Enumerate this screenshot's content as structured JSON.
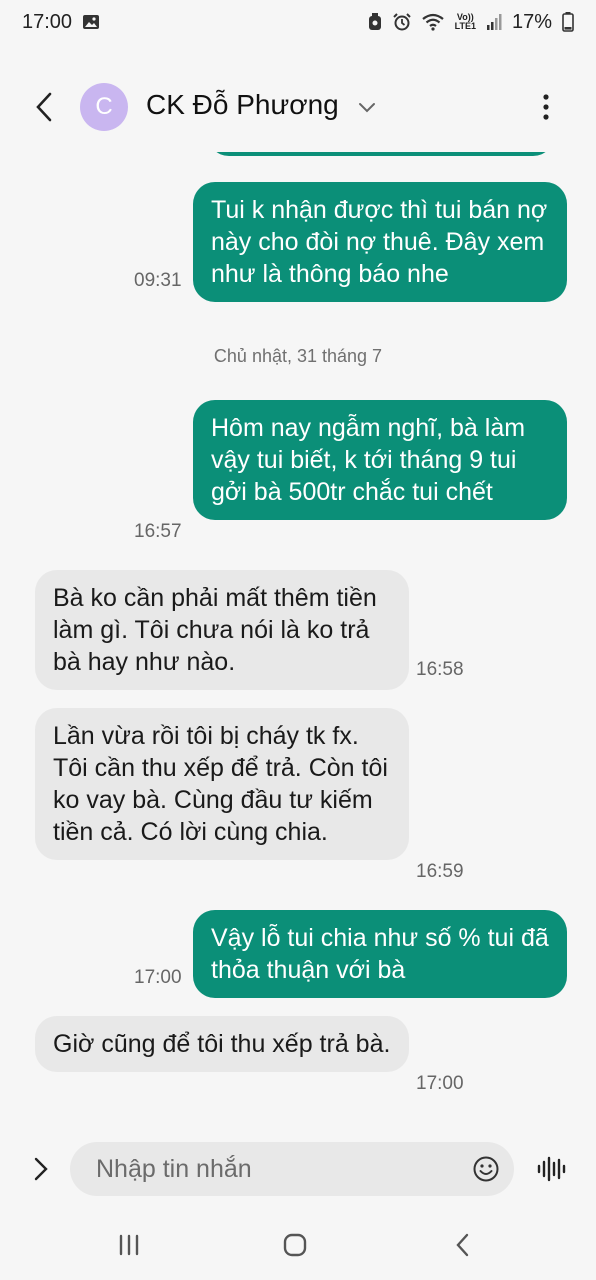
{
  "status_bar": {
    "time": "17:00",
    "battery": "17%",
    "icons": [
      "image-icon",
      "alarm-icon",
      "wifi-icon",
      "volte-icon",
      "signal-icon",
      "battery-icon"
    ],
    "lte_label_top": "Vo))",
    "lte_label_bottom": "LTE1"
  },
  "header": {
    "contact_name": "CK Đỗ Phương",
    "avatar_letter": "C",
    "avatar_color": "#c9b6f0"
  },
  "conversation": {
    "date_separator": "Chủ nhật, 31 tháng 7",
    "messages": [
      {
        "direction": "out",
        "text": "Tui k nhận được thì tui bán nợ này cho đòi nợ thuê. Đây xem như là thông báo nhe",
        "time": "09:31"
      },
      {
        "direction": "out",
        "text": "Hôm nay ngẫm nghĩ, bà làm vậy tui biết, k tới tháng 9 tui gởi bà 500tr chắc tui chết",
        "time": "16:57"
      },
      {
        "direction": "in",
        "text": "Bà ko cần phải mất thêm tiền làm gì. Tôi chưa nói là ko trả bà hay như nào.",
        "time": "16:58"
      },
      {
        "direction": "in",
        "text": "Lần vừa rồi tôi bị cháy tk fx. Tôi cần thu xếp để trả. Còn tôi ko vay bà. Cùng đầu tư kiếm tiền cả. Có lời cùng chia.",
        "time": "16:59"
      },
      {
        "direction": "out",
        "text": "Vậy lỗ tui chia như số % tui đã thỏa thuận với bà",
        "time": "17:00"
      },
      {
        "direction": "in",
        "text": "Giờ cũng để tôi thu xếp trả bà.",
        "time": "17:00"
      }
    ]
  },
  "composer": {
    "placeholder": "Nhập tin nhắn"
  },
  "colors": {
    "outgoing_bubble": "#0b8f78",
    "incoming_bubble": "#e8e8e8",
    "background": "#f6f6f6"
  }
}
